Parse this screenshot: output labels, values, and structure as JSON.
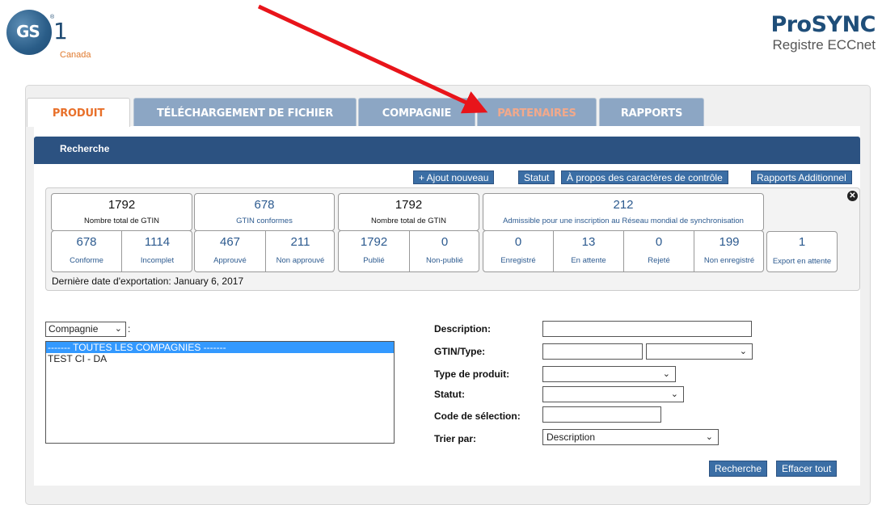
{
  "header": {
    "logo_text": "GS1",
    "logo_region": "Canada",
    "brand_title": "ProSYNC",
    "brand_subtitle": "Registre ECCnet"
  },
  "tabs": [
    {
      "label": "PRODUIT",
      "state": "active"
    },
    {
      "label": "TÉLÉCHARGEMENT DE FICHIER",
      "state": "normal"
    },
    {
      "label": "COMPAGNIE",
      "state": "normal"
    },
    {
      "label": "PARTENAIRES",
      "state": "faded"
    },
    {
      "label": "RAPPORTS",
      "state": "normal"
    }
  ],
  "section_title": "Recherche",
  "actions": {
    "add_new": "+ Ajout nouveau",
    "status": "Statut",
    "about_check": "À propos des caractères de contrôle",
    "reports": "Rapports Additionnel"
  },
  "stats": {
    "groups": [
      {
        "total": "1792",
        "label": "Nombre total de GTIN",
        "subs": [
          {
            "value": "678",
            "label": "Conforme"
          },
          {
            "value": "1114",
            "label": "Incomplet"
          }
        ]
      },
      {
        "total": "678",
        "label": "GTIN conformes",
        "subs": [
          {
            "value": "467",
            "label": "Approuvé"
          },
          {
            "value": "211",
            "label": "Non approuvé"
          }
        ]
      },
      {
        "total": "1792",
        "label": "Nombre total de GTIN",
        "subs": [
          {
            "value": "1792",
            "label": "Publié"
          },
          {
            "value": "0",
            "label": "Non-publié"
          }
        ]
      },
      {
        "total": "212",
        "label": "Admissible pour une inscription au Réseau mondial de synchronisation",
        "subs": [
          {
            "value": "0",
            "label": "Enregistré"
          },
          {
            "value": "13",
            "label": "En attente"
          },
          {
            "value": "0",
            "label": "Rejeté"
          },
          {
            "value": "199",
            "label": "Non enregistré"
          }
        ]
      }
    ],
    "export_pending": {
      "value": "1",
      "label": "Export en attente"
    },
    "last_export": "Dernière date d'exportation: January 6, 2017"
  },
  "company": {
    "select_value": "Compagnie",
    "options": [
      "------- TOUTES LES COMPAGNIES -------",
      "TEST CI - DA"
    ]
  },
  "form": {
    "description_label": "Description:",
    "gtin_label": "GTIN/Type:",
    "product_type_label": "Type de produit:",
    "status_label": "Statut:",
    "selection_code_label": "Code de sélection:",
    "sort_label": "Trier par:",
    "sort_value": "Description"
  },
  "buttons": {
    "search": "Recherche",
    "clear": "Effacer tout"
  },
  "colors": {
    "navy": "#2c5281",
    "tab_blue": "#8ca6c4",
    "active_tab_text": "#e8702a",
    "arrow": "#e8141a"
  }
}
